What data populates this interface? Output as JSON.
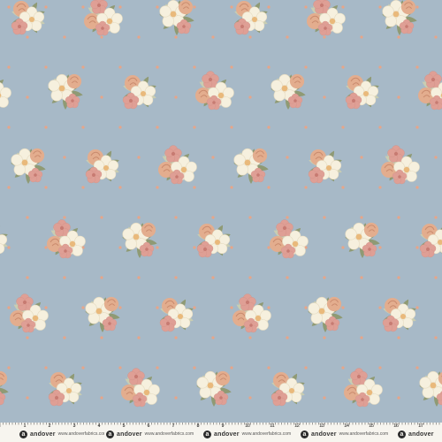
{
  "fabric": {
    "background_color": "#a7b9c7",
    "dot_color": "#e8a588",
    "leaf_color": "#8f9a74",
    "leaf_light_color": "#c9cdb2",
    "cream_flower_color": "#f6f0de",
    "cream_center_color": "#e9b97b",
    "peach_flower_color": "#e3ad8e",
    "pink_flower_color": "#df9f95"
  },
  "selvage": {
    "brand_name": "andover",
    "website": "www.andoverfabrics.com",
    "ruler_numbers": [
      "1",
      "2",
      "3",
      "4",
      "5",
      "6",
      "7",
      "8",
      "9",
      "10",
      "11",
      "12",
      "13",
      "14",
      "15",
      "16",
      "17",
      "18"
    ]
  }
}
